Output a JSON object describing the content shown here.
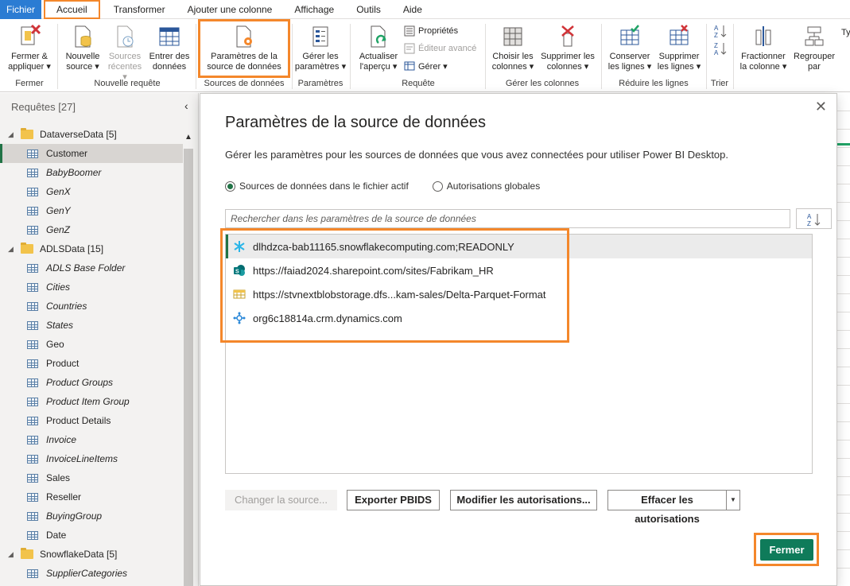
{
  "menu": {
    "file": "Fichier",
    "tabs": [
      "Accueil",
      "Transformer",
      "Ajouter une colonne",
      "Affichage",
      "Outils",
      "Aide"
    ]
  },
  "ribbon": {
    "fermer_appliquer": [
      "Fermer &",
      "appliquer"
    ],
    "nouvelle_source": [
      "Nouvelle",
      "source"
    ],
    "sources_recentes": [
      "Sources",
      "récentes"
    ],
    "entrer_donnees": [
      "Entrer des",
      "données"
    ],
    "parametres_source": [
      "Paramètres de la",
      "source de données"
    ],
    "gerer_parametres": [
      "Gérer les",
      "paramètres"
    ],
    "actualiser": [
      "Actualiser",
      "l'aperçu"
    ],
    "proprietes": "Propriétés",
    "editeur_avance": "Éditeur avancé",
    "gerer": "Gérer",
    "choisir_colonnes": [
      "Choisir les",
      "colonnes"
    ],
    "supprimer_colonnes": [
      "Supprimer les",
      "colonnes"
    ],
    "conserver_lignes": [
      "Conserver",
      "les lignes"
    ],
    "supprimer_lignes": [
      "Supprimer",
      "les lignes"
    ],
    "fractionner": [
      "Fractionner",
      "la colonne"
    ],
    "regrouper": [
      "Regrouper",
      "par"
    ],
    "type_partial": "Ty",
    "groups": {
      "fermer": "Fermer",
      "nouvelle_requete": "Nouvelle requête",
      "sources_donnees": "Sources de données",
      "parametres": "Paramètres",
      "requete": "Requête",
      "gerer_colonnes": "Gérer les colonnes",
      "reduire_lignes": "Réduire les lignes",
      "trier": "Trier"
    }
  },
  "queries": {
    "header": "Requêtes [27]",
    "groups": [
      {
        "name": "DataverseData [5]",
        "items": [
          {
            "label": "Customer",
            "italic": false
          },
          {
            "label": "BabyBoomer",
            "italic": true
          },
          {
            "label": "GenX",
            "italic": true
          },
          {
            "label": "GenY",
            "italic": true
          },
          {
            "label": "GenZ",
            "italic": true
          }
        ]
      },
      {
        "name": "ADLSData [15]",
        "items": [
          {
            "label": "ADLS Base Folder",
            "italic": true
          },
          {
            "label": "Cities",
            "italic": true
          },
          {
            "label": "Countries",
            "italic": true
          },
          {
            "label": "States",
            "italic": true
          },
          {
            "label": "Geo",
            "italic": false
          },
          {
            "label": "Product",
            "italic": false
          },
          {
            "label": "Product Groups",
            "italic": true
          },
          {
            "label": "Product Item Group",
            "italic": true
          },
          {
            "label": "Product Details",
            "italic": false
          },
          {
            "label": "Invoice",
            "italic": true
          },
          {
            "label": "InvoiceLineItems",
            "italic": true
          },
          {
            "label": "Sales",
            "italic": false
          },
          {
            "label": "Reseller",
            "italic": false
          },
          {
            "label": "BuyingGroup",
            "italic": true
          },
          {
            "label": "Date",
            "italic": false
          }
        ]
      },
      {
        "name": "SnowflakeData [5]",
        "items": [
          {
            "label": "SupplierCategories",
            "italic": true
          }
        ]
      }
    ]
  },
  "dialog": {
    "title": "Paramètres de la source de données",
    "description": "Gérer les paramètres pour les sources de données que vous avez connectées pour utiliser Power BI Desktop.",
    "radio_current": "Sources de données dans le fichier actif",
    "radio_global": "Autorisations globales",
    "search_placeholder": "Rechercher dans les paramètres de la source de données",
    "sources": [
      {
        "label": "dlhdzca-bab11165.snowflakecomputing.com;READONLY",
        "icon": "snowflake-icon"
      },
      {
        "label": "https://faiad2024.sharepoint.com/sites/Fabrikam_HR",
        "icon": "sharepoint-icon"
      },
      {
        "label": "https://stvnextblobstorage.dfs...kam-sales/Delta-Parquet-Format",
        "icon": "datalake-icon"
      },
      {
        "label": "org6c18814a.crm.dynamics.com",
        "icon": "dataverse-icon"
      }
    ],
    "btn_change": "Changer la source...",
    "btn_export": "Exporter PBIDS",
    "btn_edit": "Modifier les autorisations...",
    "btn_clear": "Effacer les autorisations",
    "btn_close": "Fermer"
  },
  "colors": {
    "accent_green": "#217346",
    "highlight_orange": "#f4872b",
    "file_blue": "#2b7cd3"
  }
}
